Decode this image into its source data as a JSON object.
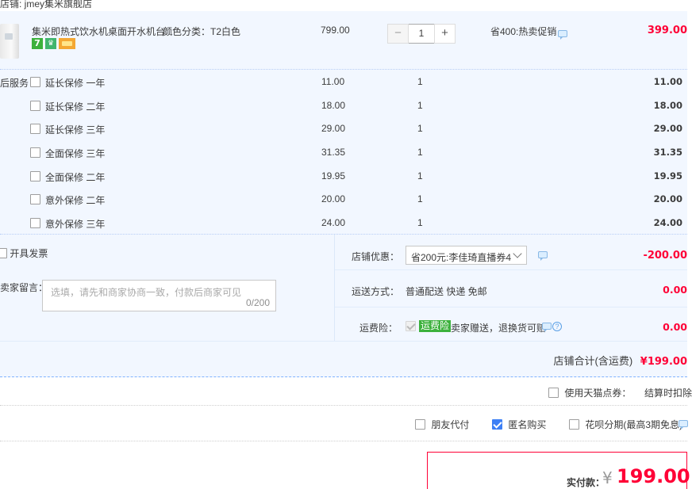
{
  "store": {
    "header": "店铺: jmey集米旗舰店"
  },
  "product": {
    "title": "集米即热式饮水机桌面开水机台...",
    "attr": "颜色分类：T2白色",
    "badges": [
      "7"
    ],
    "unit_price": "799.00",
    "quantity": "1",
    "qty_minus": "−",
    "qty_plus": "+",
    "promo": "省400:热卖促销",
    "line_total": "399.00"
  },
  "services": {
    "label": "后服务",
    "items": [
      {
        "name": "延长保修 一年",
        "price": "11.00",
        "qty": "1",
        "sum": "11.00"
      },
      {
        "name": "延长保修 二年",
        "price": "18.00",
        "qty": "1",
        "sum": "18.00"
      },
      {
        "name": "延长保修 三年",
        "price": "29.00",
        "qty": "1",
        "sum": "29.00"
      },
      {
        "name": "全面保修 三年",
        "price": "31.35",
        "qty": "1",
        "sum": "31.35"
      },
      {
        "name": "全面保修 二年",
        "price": "19.95",
        "qty": "1",
        "sum": "19.95"
      },
      {
        "name": "意外保修 二年",
        "price": "20.00",
        "qty": "1",
        "sum": "20.00"
      },
      {
        "name": "意外保修 三年",
        "price": "24.00",
        "qty": "1",
        "sum": "24.00"
      }
    ]
  },
  "invoice": {
    "label": "开具发票"
  },
  "message": {
    "label": "卖家留言：",
    "placeholder": "选填，请先和商家协商一致，付款后商家可见",
    "counter": "0/200"
  },
  "discount": {
    "label": "店铺优惠：",
    "selected": "省200元:李佳琦直播券4",
    "amount": "-200.00"
  },
  "shipping": {
    "label": "运送方式：",
    "value": "普通配送 快递 免邮",
    "amount": "0.00"
  },
  "insurance": {
    "label": "运费险：",
    "tag": "运费险",
    "text": "卖家赠送，退换货可赔",
    "help": "?",
    "amount": "0.00"
  },
  "store_total": {
    "label": "店铺合计(含运费)",
    "amount": "¥199.00"
  },
  "tmall_points": {
    "label": "使用天猫点券：",
    "note": "结算时扣除"
  },
  "options": {
    "friend_pay": "朋友代付",
    "anonymous": "匿名购买",
    "huabei": "花呗分期(最高3期免息)"
  },
  "payment": {
    "label": "实付款：",
    "currency": "¥",
    "amount": "199.00"
  },
  "colors": {
    "accent_red": "#ff0036",
    "accent_blue": "#3d7ff5",
    "tag_green": "#3cb13c"
  }
}
